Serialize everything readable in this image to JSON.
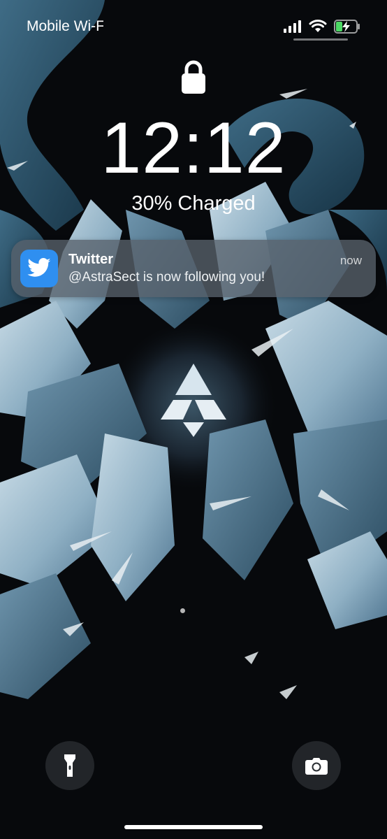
{
  "status_bar": {
    "carrier": "Mobile Wi-Fi",
    "signal_icon": "cellular-signal-icon",
    "wifi_icon": "wifi-icon",
    "battery_icon": "battery-charging-icon",
    "battery_color": "#4cd964"
  },
  "lock_screen": {
    "lock_icon": "lock-icon",
    "time": "12:12",
    "charge_status": "30% Charged"
  },
  "notification": {
    "app_name": "Twitter",
    "time": "now",
    "message": "@AstraSect is now following you!",
    "app_icon": "twitter-bird-icon",
    "app_color": "#2f8ff0"
  },
  "quick_actions": {
    "flashlight_icon": "flashlight-icon",
    "camera_icon": "camera-icon"
  },
  "wallpaper": {
    "description_icon": "astrasect-logo-icon"
  }
}
